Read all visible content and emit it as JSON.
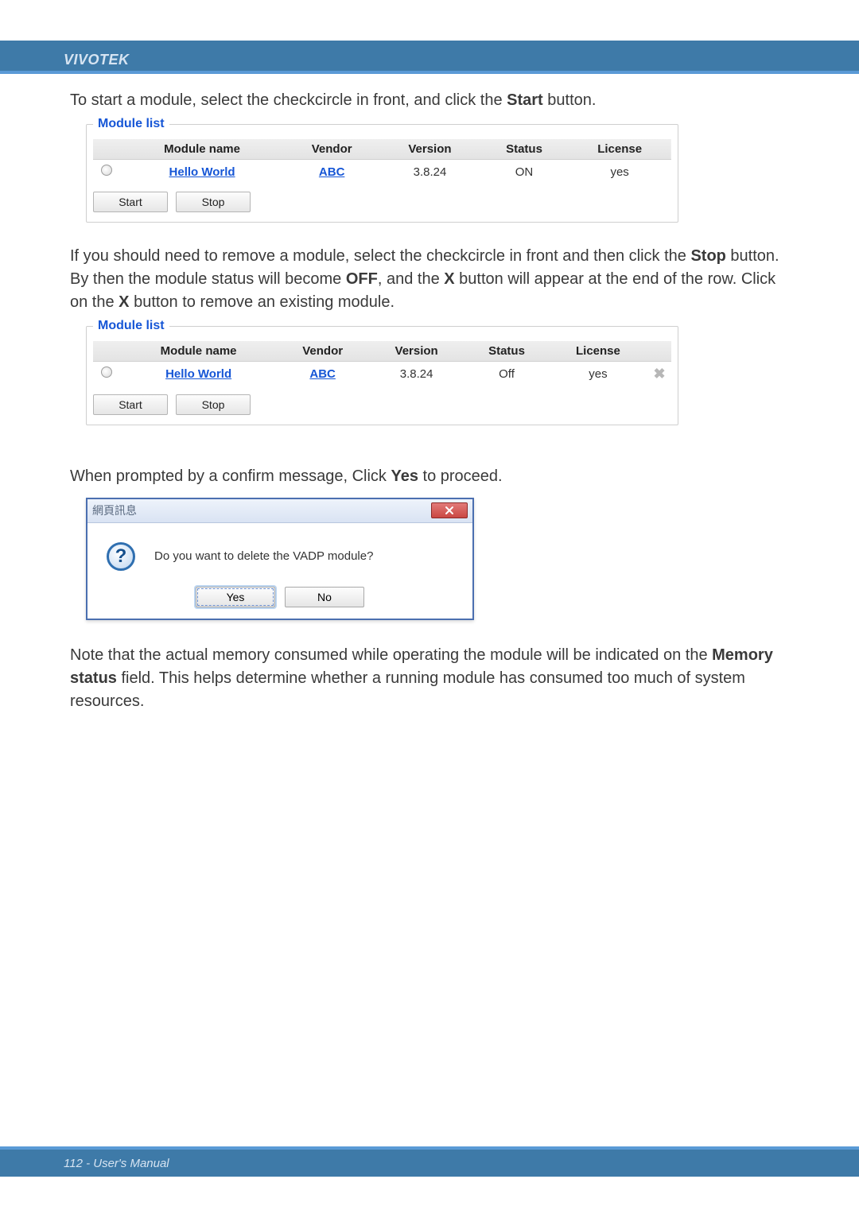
{
  "brand": "VIVOTEK",
  "intro1_pre": "To start a module, select the checkcircle in front, and click the ",
  "intro1_bold": "Start",
  "intro1_post": " button.",
  "list1": {
    "legend": "Module list",
    "headers": {
      "name": "Module name",
      "vendor": "Vendor",
      "version": "Version",
      "status": "Status",
      "license": "License"
    },
    "row": {
      "name": "Hello World",
      "vendor": "ABC",
      "version": "3.8.24",
      "status": "ON",
      "license": "yes"
    },
    "start": "Start",
    "stop": "Stop"
  },
  "para2_a": "If you should need to remove a module, select the checkcircle in front and then click the ",
  "para2_b": "Stop",
  "para2_c": " button. By then the module status will become ",
  "para2_d": "OFF",
  "para2_e": ", and the ",
  "para2_f": "X",
  "para2_g": " button will appear at the end of the row. Click on the ",
  "para2_h": "X",
  "para2_i": " button to remove an existing module.",
  "list2": {
    "legend": "Module list",
    "headers": {
      "name": "Module name",
      "vendor": "Vendor",
      "version": "Version",
      "status": "Status",
      "license": "License"
    },
    "row": {
      "name": "Hello World",
      "vendor": "ABC",
      "version": "3.8.24",
      "status": "Off",
      "license": "yes"
    },
    "start": "Start",
    "stop": "Stop"
  },
  "para3_a": "When prompted by a confirm message, Click ",
  "para3_b": "Yes",
  "para3_c": " to proceed.",
  "dialog": {
    "title": "網頁訊息",
    "message": "Do you want to delete the VADP module?",
    "yes": "Yes",
    "no": "No",
    "qmark": "?"
  },
  "para4_a": "Note that the actual memory consumed while operating the module will be indicated on the ",
  "para4_b": "Memory status",
  "para4_c": " field. This helps determine whether a running module has consumed too much of system resources.",
  "footer": "112 - User's Manual"
}
